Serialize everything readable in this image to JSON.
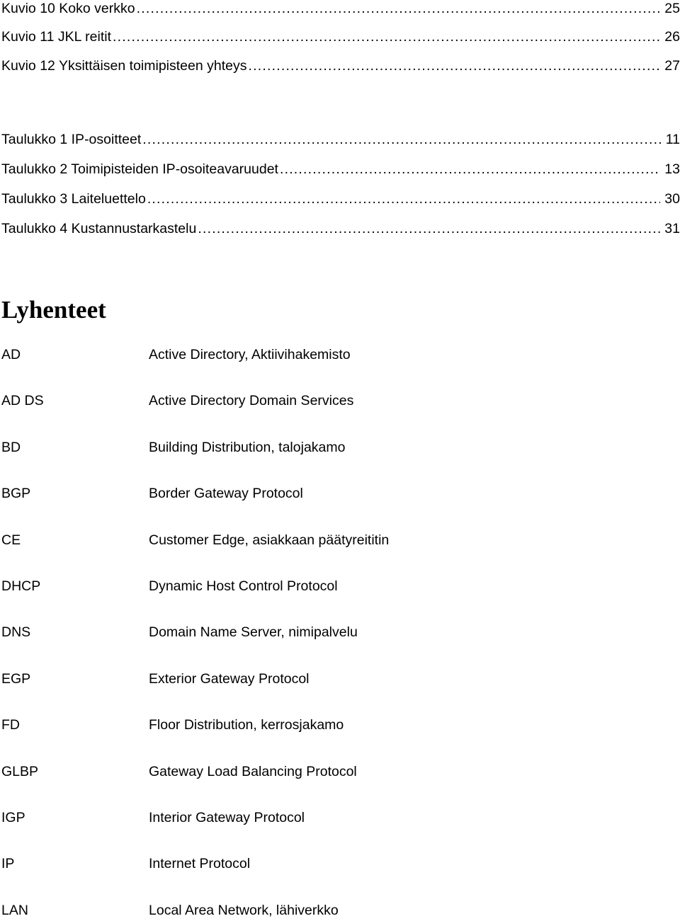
{
  "figures_list": [
    {
      "title": "Kuvio 10 Koko verkko",
      "page": "25"
    },
    {
      "title": "Kuvio 11 JKL reitit",
      "page": "26"
    },
    {
      "title": "Kuvio 12 Yksittäisen toimipisteen yhteys",
      "page": "27"
    }
  ],
  "tables_list": [
    {
      "title": "Taulukko 1 IP-osoitteet",
      "page": "11"
    },
    {
      "title": "Taulukko 2 Toimipisteiden IP-osoiteavaruudet",
      "page": "13"
    },
    {
      "title": "Taulukko 3 Laiteluettelo",
      "page": "30"
    },
    {
      "title": "Taulukko 4 Kustannustarkastelu",
      "page": "31"
    }
  ],
  "abbreviations": {
    "heading": "Lyhenteet",
    "items": [
      {
        "term": "AD",
        "definition": "Active Directory, Aktiivihakemisto"
      },
      {
        "term": "AD DS",
        "definition": "Active Directory Domain Services"
      },
      {
        "term": "BD",
        "definition": "Building Distribution, talojakamo"
      },
      {
        "term": "BGP",
        "definition": "Border Gateway Protocol"
      },
      {
        "term": "CE",
        "definition": "Customer Edge, asiakkaan päätyreititin"
      },
      {
        "term": "DHCP",
        "definition": "Dynamic Host Control Protocol"
      },
      {
        "term": "DNS",
        "definition": "Domain Name Server, nimipalvelu"
      },
      {
        "term": "EGP",
        "definition": "Exterior Gateway Protocol"
      },
      {
        "term": "FD",
        "definition": "Floor Distribution, kerrosjakamo"
      },
      {
        "term": "GLBP",
        "definition": "Gateway Load Balancing Protocol"
      },
      {
        "term": "IGP",
        "definition": "Interior Gateway Protocol"
      },
      {
        "term": "IP",
        "definition": "Internet Protocol"
      },
      {
        "term": "LAN",
        "definition": "Local Area Network, lähiverkko"
      }
    ]
  }
}
